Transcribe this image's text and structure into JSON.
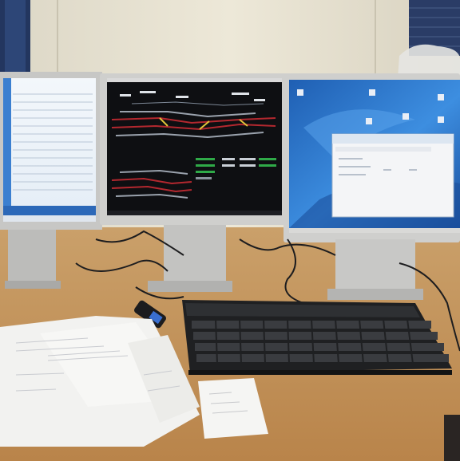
{
  "scene": {
    "kind": "photo",
    "subject": "office desk",
    "objects": [
      "left-monitor",
      "center-monitor",
      "right-monitor",
      "keyboard",
      "usb-stick",
      "paper-documents",
      "receipt",
      "cables"
    ]
  },
  "colors": {
    "wall": "#e8e2d0",
    "desk": "#c99a5e",
    "monitor_bezel": "#c8c8c8",
    "center_screen": "#0e0f12",
    "track_red": "#b3282f",
    "track_grey": "#9aa2ad",
    "track_green": "#2faa48",
    "desktop_blue": "#2a74c9",
    "window_white": "#f4f5f7",
    "keyboard": "#1f2022",
    "paper": "#f2f2f0"
  }
}
